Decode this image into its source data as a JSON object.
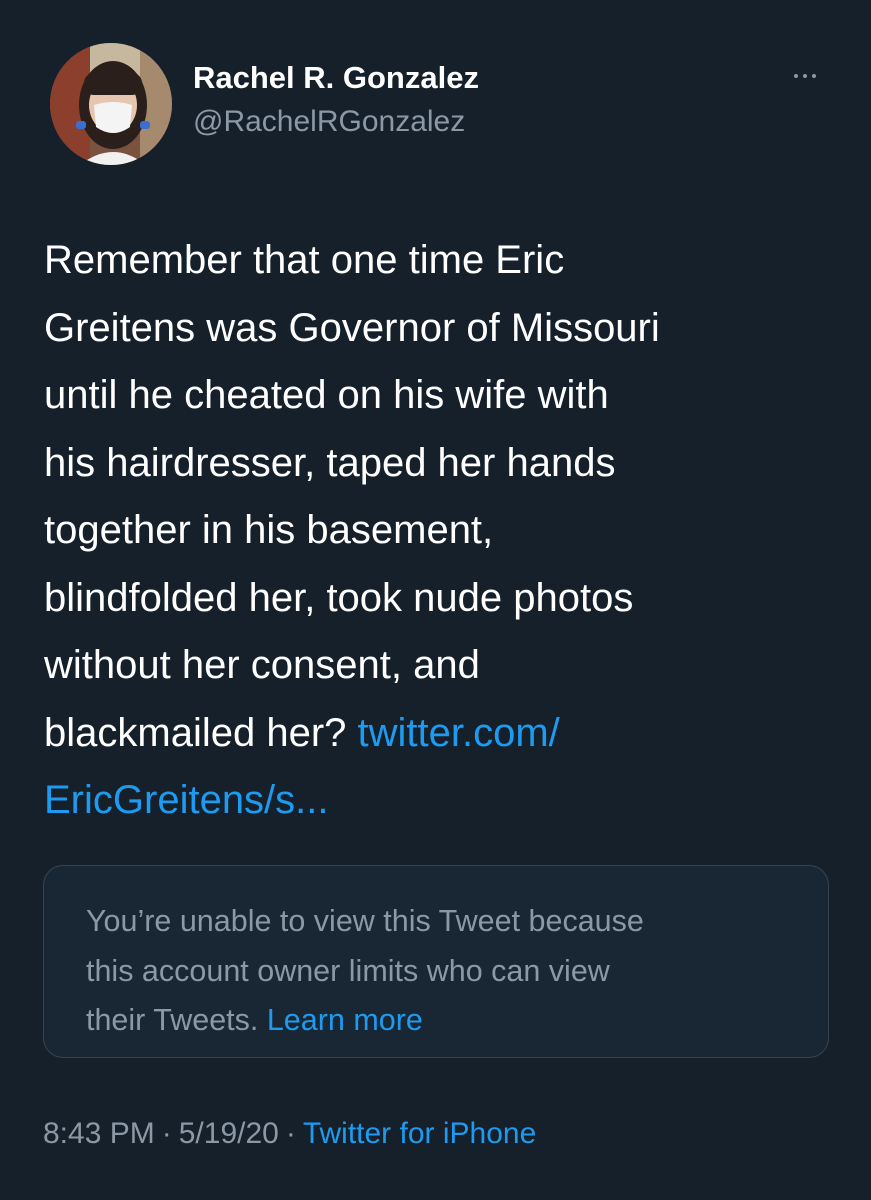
{
  "author": {
    "name": "Rachel R. Gonzalez",
    "handle": "@RachelRGonzalez"
  },
  "tweet": {
    "lines": [
      "Remember that one time Eric",
      "Greitens was Governor of Missouri",
      "until he cheated on his wife with",
      "his hairdresser, taped her hands",
      "together in his basement,",
      "blindfolded her, took nude photos",
      "without her consent, and"
    ],
    "last_line_text": "blackmailed her?",
    "link_part1": "twitter.com/",
    "link_part2": "EricGreitens/s..."
  },
  "quoted_card": {
    "line1": "You’re unable to view this Tweet because",
    "line2": "this account owner limits who can view",
    "line3_text": "their Tweets.",
    "learn_more": "Learn more"
  },
  "meta": {
    "time": "8:43 PM",
    "separator": "·",
    "date": "5/19/20",
    "source": "Twitter for iPhone"
  },
  "icons": {
    "more": "more-horizontal-icon"
  },
  "colors": {
    "background": "#15202b",
    "text": "#ffffff",
    "secondary": "#8b98a5",
    "link": "#1d9bf0",
    "card_border": "#38444d"
  }
}
